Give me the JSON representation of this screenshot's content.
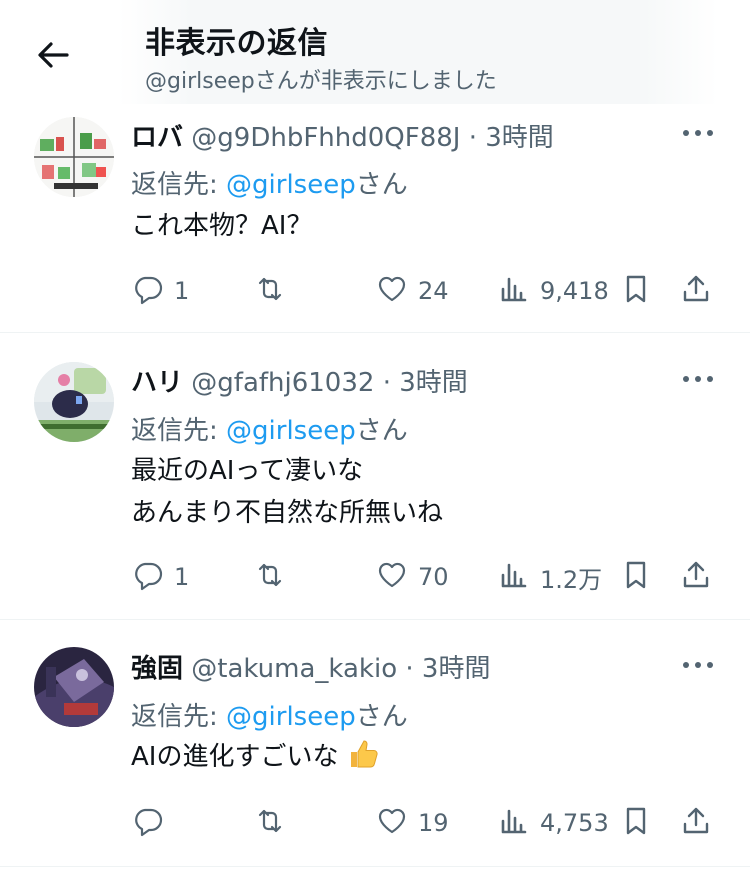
{
  "header": {
    "title": "非表示の返信",
    "subtitle": "@girlseepさんが非表示にしました"
  },
  "replies": [
    {
      "display_name": "ロバ",
      "handle": "@g9DhbFhhd0QF88J",
      "separator": "·",
      "time": "3時間",
      "reply_prefix": "返信先: ",
      "reply_mention": "@girlseep",
      "reply_suffix": "さん",
      "lines": [
        "これ本物？AI？"
      ],
      "replies_count": "1",
      "reposts_count": "",
      "likes_count": "24",
      "views_count": "9,418"
    },
    {
      "display_name": "ハリ",
      "handle": "@gfafhj61032",
      "separator": "·",
      "time": "3時間",
      "reply_prefix": "返信先: ",
      "reply_mention": "@girlseep",
      "reply_suffix": "さん",
      "lines": [
        "最近のAIって凄いな",
        "あんまり不自然な所無いね"
      ],
      "replies_count": "1",
      "reposts_count": "",
      "likes_count": "70",
      "views_count": "1.2万"
    },
    {
      "display_name": "強固",
      "handle": "@takuma_kakio",
      "separator": "·",
      "time": "3時間",
      "reply_prefix": "返信先: ",
      "reply_mention": "@girlseep",
      "reply_suffix": "さん",
      "lines": [
        "AIの進化すごいな"
      ],
      "replies_count": "",
      "reposts_count": "",
      "likes_count": "19",
      "views_count": "4,753"
    }
  ],
  "colors": {
    "text": "#0f1419",
    "secondary": "#536471",
    "link": "#1d9bf0",
    "divider": "#eff3f4"
  },
  "icons": [
    "back-arrow-icon",
    "more-icon",
    "reply-icon",
    "repost-icon",
    "like-icon",
    "views-icon",
    "bookmark-icon",
    "share-icon",
    "thumbs-up-emoji"
  ]
}
